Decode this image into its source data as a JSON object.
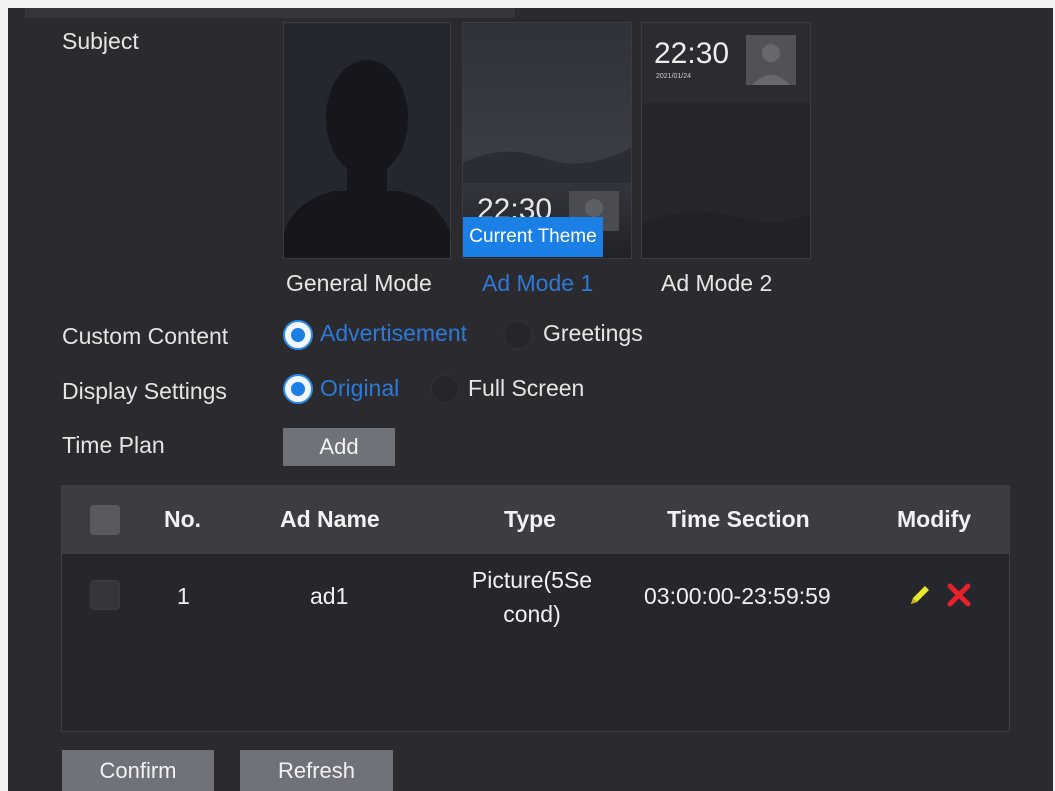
{
  "form": {
    "subject_label": "Subject",
    "themes": [
      {
        "name": "General Mode",
        "active": false
      },
      {
        "name": "Ad Mode 1",
        "active": true
      },
      {
        "name": "Ad Mode 2",
        "active": false
      }
    ],
    "theme_preview": {
      "time": "22:30",
      "date": "2021/01/24",
      "current_badge": "Current Theme"
    },
    "custom_content": {
      "label": "Custom Content",
      "options": [
        "Advertisement",
        "Greetings"
      ],
      "selected": "Advertisement"
    },
    "display_settings": {
      "label": "Display Settings",
      "options": [
        "Original",
        "Full Screen"
      ],
      "selected": "Original"
    },
    "time_plan": {
      "label": "Time Plan",
      "add_button": "Add"
    }
  },
  "table": {
    "columns": [
      "No.",
      "Ad Name",
      "Type",
      "Time Section",
      "Modify"
    ],
    "rows": [
      {
        "no": "1",
        "ad_name": "ad1",
        "type_line1": "Picture(5Se",
        "type_line2": "cond)",
        "time_section": "03:00:00-23:59:59"
      }
    ]
  },
  "footer": {
    "confirm": "Confirm",
    "refresh": "Refresh"
  },
  "colors": {
    "accent": "#1b80e5",
    "active_text": "#2d79d8",
    "edit_icon": "#e8e830",
    "delete_icon": "#e8202a"
  },
  "icons": {
    "edit": "pencil-icon",
    "delete": "close-icon"
  }
}
